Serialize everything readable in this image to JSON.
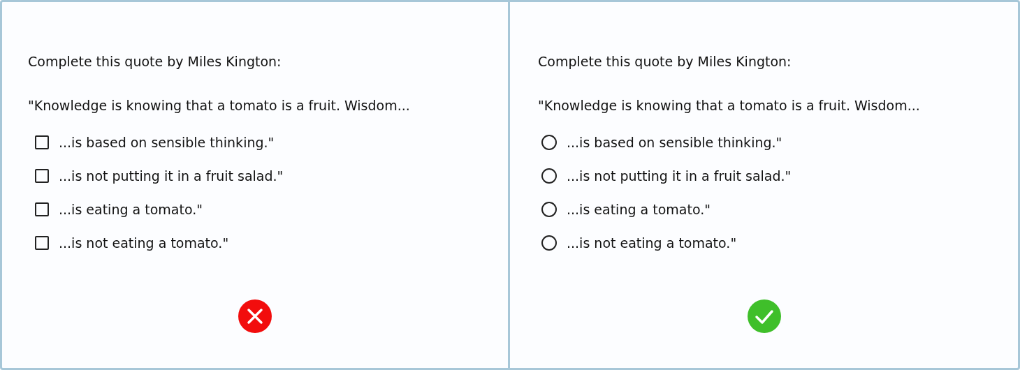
{
  "panels": [
    {
      "kind": "checkbox",
      "prompt": "Complete this quote by Miles Kington:",
      "quote": "\"Knowledge is knowing that a tomato is a fruit. Wisdom...",
      "options": [
        {
          "label": "...is based on sensible thinking.\"",
          "checked": false
        },
        {
          "label": "...is not putting it in a fruit salad.\"",
          "checked": false
        },
        {
          "label": "...is eating a tomato.\"",
          "checked": false
        },
        {
          "label": "...is not eating a tomato.\"",
          "checked": false
        }
      ],
      "correct": false
    },
    {
      "kind": "radio",
      "prompt": "Complete this quote by Miles Kington:",
      "quote": "\"Knowledge is knowing that a tomato is a fruit. Wisdom...",
      "options": [
        {
          "label": "...is based on sensible thinking.\"",
          "selected": false
        },
        {
          "label": "...is not putting it in a fruit salad.\"",
          "selected": false
        },
        {
          "label": "...is eating a tomato.\"",
          "selected": false
        },
        {
          "label": "...is not eating a tomato.\"",
          "selected": false
        }
      ],
      "correct": true
    }
  ]
}
